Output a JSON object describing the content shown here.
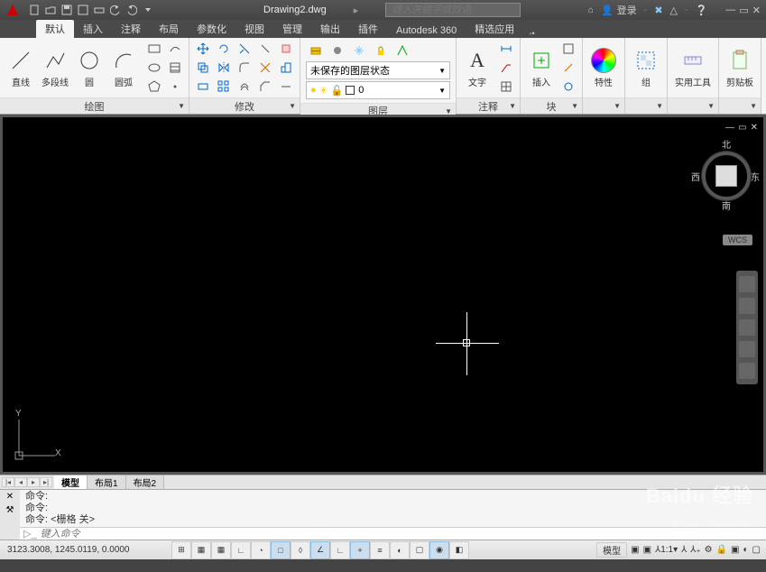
{
  "title": "Drawing2.dwg",
  "search_placeholder": "键入关键字或短语",
  "login_label": "登录",
  "menu_tabs": [
    "默认",
    "插入",
    "注释",
    "布局",
    "参数化",
    "视图",
    "管理",
    "输出",
    "插件",
    "Autodesk 360",
    "精选应用"
  ],
  "active_menu_tab": 0,
  "ribbon": {
    "draw": {
      "title": "绘图",
      "items": {
        "line": "直线",
        "polyline": "多段线",
        "circle": "圆",
        "arc": "圆弧"
      }
    },
    "modify": {
      "title": "修改"
    },
    "layer": {
      "title": "图层",
      "state_label": "未保存的图层状态",
      "current_layer": "0"
    },
    "annotation": {
      "title": "注释",
      "text_btn": "文字"
    },
    "block": {
      "title": "块",
      "insert_btn": "插入"
    },
    "properties": {
      "title": "特性"
    },
    "groups": {
      "title": "组"
    },
    "utilities": {
      "title": "实用工具"
    },
    "clipboard": {
      "title": "剪贴板"
    }
  },
  "viewport": {
    "compass": {
      "n": "北",
      "s": "南",
      "e": "东",
      "w": "西"
    },
    "wcs": "WCS",
    "ucs": {
      "x": "X",
      "y": "Y"
    }
  },
  "layout_tabs": [
    "模型",
    "布局1",
    "布局2"
  ],
  "active_layout_tab": 0,
  "command": {
    "history": [
      "命令:",
      "命令:",
      "命令:  <栅格 关>"
    ],
    "input_placeholder": "键入命令"
  },
  "status": {
    "coords": "3123.3008, 1245.0119, 0.0000",
    "model_label": "模型",
    "scale_label": "1:1"
  },
  "watermark": {
    "main": "Baidu 经验",
    "sub": "jingyan.baidu.com"
  }
}
